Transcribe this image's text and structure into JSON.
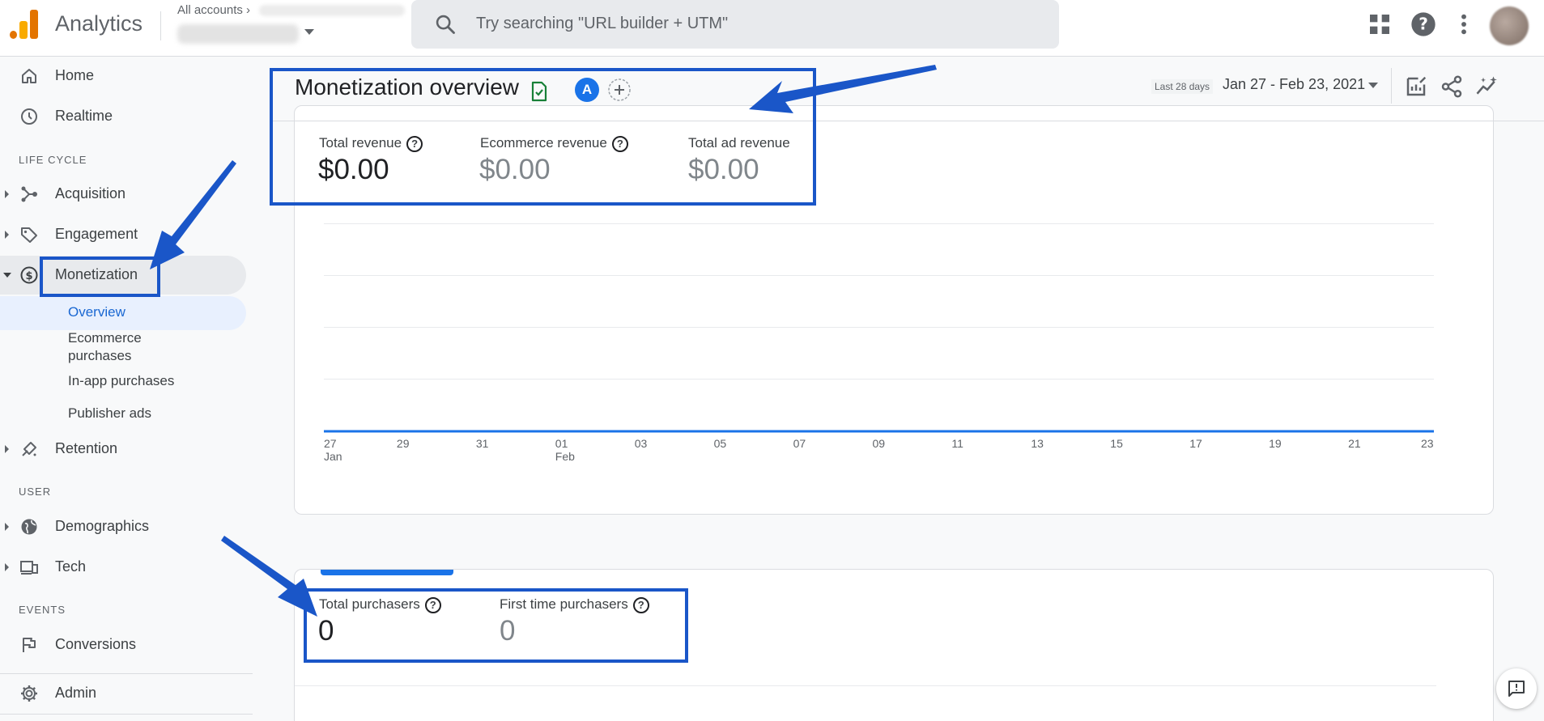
{
  "header": {
    "app_title": "Analytics",
    "accounts_label": "All accounts",
    "search_placeholder": "Try searching \"URL builder + UTM\""
  },
  "colors": {
    "accent_blue": "#1a73e8",
    "annotation_blue": "#1a56c8",
    "logo_orange": "#f9ab00",
    "logo_dark_orange": "#e37400",
    "report_green": "#188038"
  },
  "sidebar": {
    "home": "Home",
    "realtime": "Realtime",
    "section_lifecycle": "LIFE CYCLE",
    "acquisition": "Acquisition",
    "engagement": "Engagement",
    "monetization": "Monetization",
    "monetization_sub": {
      "overview": "Overview",
      "ecommerce_line1": "Ecommerce",
      "ecommerce_line2": "purchases",
      "inapp": "In-app purchases",
      "publisher_ads": "Publisher ads"
    },
    "retention": "Retention",
    "section_user": "USER",
    "demographics": "Demographics",
    "tech": "Tech",
    "section_events": "EVENTS",
    "conversions": "Conversions",
    "admin": "Admin"
  },
  "page": {
    "title": "Monetization overview",
    "comparison_avatar": "A",
    "date_preset": "Last 28 days",
    "date_range": "Jan 27 - Feb 23, 2021"
  },
  "revenue_card": {
    "total_revenue_label": "Total revenue",
    "total_revenue_value": "$0.00",
    "ecommerce_revenue_label": "Ecommerce revenue",
    "ecommerce_revenue_value": "$0.00",
    "total_ad_revenue_label": "Total ad revenue",
    "total_ad_revenue_value": "$0.00"
  },
  "chart_data": {
    "type": "line",
    "x": [
      "27 Jan",
      "29",
      "31",
      "01 Feb",
      "03",
      "05",
      "07",
      "09",
      "11",
      "13",
      "15",
      "17",
      "19",
      "21",
      "23"
    ],
    "series": [
      {
        "values": [
          0,
          0,
          0,
          0,
          0,
          0,
          0,
          0,
          0,
          0,
          0,
          0,
          0,
          0,
          0
        ]
      }
    ],
    "tick_labels": [
      {
        "day": "27",
        "month": "Jan"
      },
      {
        "day": "29",
        "month": ""
      },
      {
        "day": "31",
        "month": ""
      },
      {
        "day": "01",
        "month": "Feb"
      },
      {
        "day": "03",
        "month": ""
      },
      {
        "day": "05",
        "month": ""
      },
      {
        "day": "07",
        "month": ""
      },
      {
        "day": "09",
        "month": ""
      },
      {
        "day": "11",
        "month": ""
      },
      {
        "day": "13",
        "month": ""
      },
      {
        "day": "15",
        "month": ""
      },
      {
        "day": "17",
        "month": ""
      },
      {
        "day": "19",
        "month": ""
      },
      {
        "day": "21",
        "month": ""
      },
      {
        "day": "23",
        "month": ""
      }
    ],
    "grid": true
  },
  "purchasers_card": {
    "total_purchasers_label": "Total purchasers",
    "total_purchasers_value": "0",
    "first_time_label": "First time purchasers",
    "first_time_value": "0"
  },
  "icons": [
    "search-icon",
    "apps-grid-icon",
    "help-icon",
    "more-vert-icon",
    "home-icon",
    "clock-icon",
    "acquisition-icon",
    "tag-icon",
    "dollar-icon",
    "retention-icon",
    "globe-icon",
    "devices-icon",
    "flag-icon",
    "gear-icon",
    "report-check-icon",
    "add-comparison-icon",
    "customize-report-icon",
    "share-icon",
    "insights-icon",
    "feedback-icon"
  ]
}
